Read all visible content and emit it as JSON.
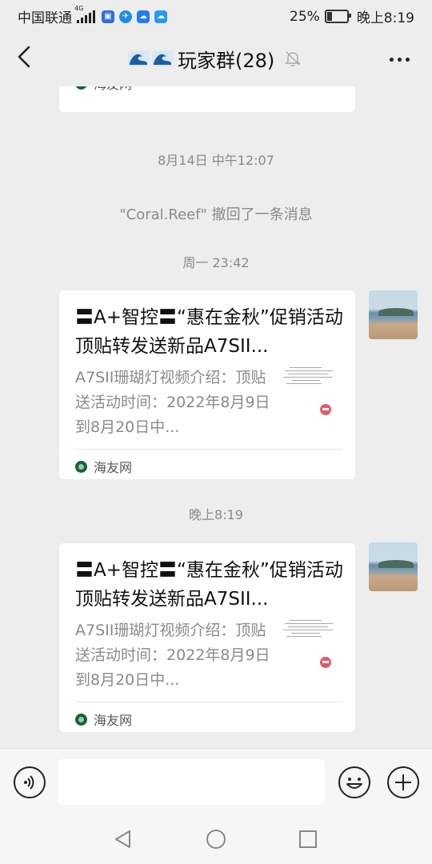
{
  "status_bar": {
    "carrier": "中国联通",
    "network": "4G",
    "battery_percent": "25%",
    "battery_level": 0.25,
    "time": "晚上8:19",
    "icons": [
      "signal-icon",
      "shield-app-icon",
      "browser-app-icon",
      "cloud-app-icon",
      "weather-app-icon",
      "battery-icon"
    ]
  },
  "header": {
    "title": "玩家群(28)",
    "icons": [
      "back-icon",
      "wave-emoji-icon",
      "mute-bell-icon",
      "more-icon"
    ]
  },
  "messages": {
    "partial_source": "海友网",
    "time_1": "8月14日 中午12:07",
    "recall_notice": "\"Coral.Reef\" 撤回了一条消息",
    "time_2": "周一 23:42",
    "card_1": {
      "title": "〓A+智控〓“惠在金秋”促销活动顶贴转发送新品A7SII...",
      "description": "A7SII珊瑚灯视频介绍：顶贴送活动时间：2022年8月9日到8月20日中...",
      "source": "海友网"
    },
    "time_3": "晚上8:19",
    "card_2": {
      "title": "〓A+智控〓“惠在金秋”促销活动顶贴转发送新品A7SII...",
      "description": "A7SII珊瑚灯视频介绍：顶贴送活动时间：2022年8月9日到8月20日中...",
      "source": "海友网"
    }
  },
  "input_bar": {
    "message_value": "",
    "icons": [
      "voice-icon",
      "emoji-icon",
      "add-icon"
    ]
  },
  "nav_bar": {
    "icons": [
      "nav-back-icon",
      "nav-home-icon",
      "nav-recents-icon"
    ]
  }
}
